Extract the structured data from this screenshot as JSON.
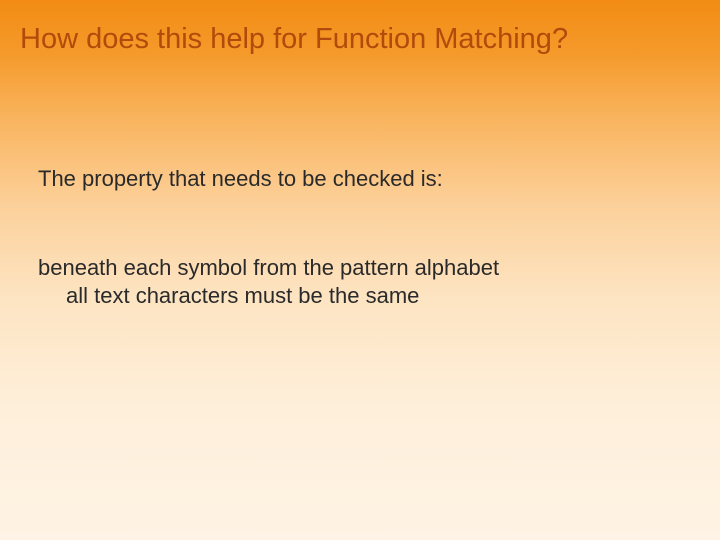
{
  "slide": {
    "title": "How does this help for Function Matching?",
    "intro": "The property that needs to be checked is:",
    "statement_line1": "beneath each symbol from the  pattern alphabet",
    "statement_line2": "all   text characters must be the same"
  }
}
